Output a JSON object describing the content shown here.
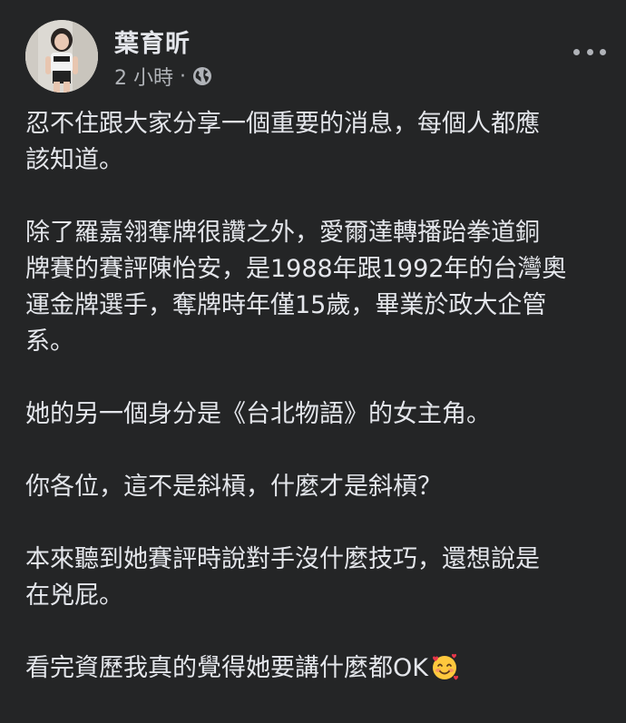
{
  "post": {
    "author": "葉育昕",
    "timestamp": "2 小時",
    "separator": "·",
    "privacy_icon": "globe-icon",
    "more_icon": "more-options-icon",
    "paragraphs": [
      "忍不住跟大家分享一個重要的消息，每個人都應\n該知道。",
      "除了羅嘉翎奪牌很讚之外，愛爾達轉播跆拳道銅\n牌賽的賽評陳怡安，是1988年跟1992年的台灣奧\n運金牌選手，奪牌時年僅15歲，畢業於政大企管\n系。",
      "她的另一個身分是《台北物語》的女主角。",
      "你各位，這不是斜槓，什麼才是斜槓？",
      "本來聽到她賽評時說對手沒什麼技巧，還想說是\n在兇屁。",
      "看完資歷我真的覺得她要講什麼都OK"
    ],
    "last_emoji": "smiling-face-with-hearts-icon"
  },
  "colors": {
    "background": "#242526",
    "primary_text": "#e4e6eb",
    "secondary_text": "#b0b3b8"
  }
}
